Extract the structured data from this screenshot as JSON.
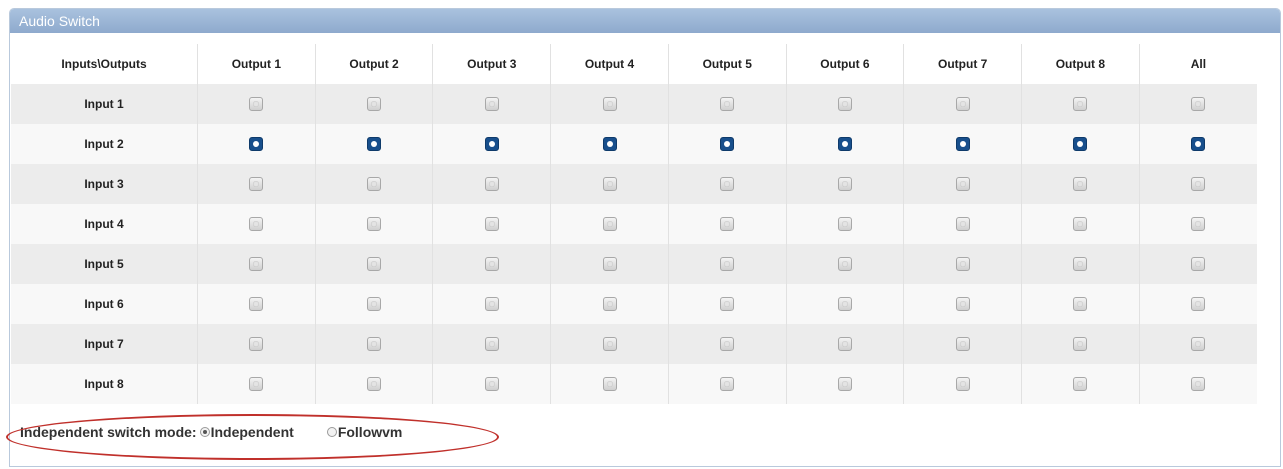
{
  "panel": {
    "title": "Audio Switch"
  },
  "matrix": {
    "corner_label": "Inputs\\Outputs",
    "columns": [
      "Output 1",
      "Output 2",
      "Output 3",
      "Output 4",
      "Output 5",
      "Output 6",
      "Output 7",
      "Output 8",
      "All"
    ],
    "rows": [
      {
        "label": "Input 1",
        "selected": [
          false,
          false,
          false,
          false,
          false,
          false,
          false,
          false,
          false
        ]
      },
      {
        "label": "Input 2",
        "selected": [
          true,
          true,
          true,
          true,
          true,
          true,
          true,
          true,
          true
        ]
      },
      {
        "label": "Input 3",
        "selected": [
          false,
          false,
          false,
          false,
          false,
          false,
          false,
          false,
          false
        ]
      },
      {
        "label": "Input 4",
        "selected": [
          false,
          false,
          false,
          false,
          false,
          false,
          false,
          false,
          false
        ]
      },
      {
        "label": "Input 5",
        "selected": [
          false,
          false,
          false,
          false,
          false,
          false,
          false,
          false,
          false
        ]
      },
      {
        "label": "Input 6",
        "selected": [
          false,
          false,
          false,
          false,
          false,
          false,
          false,
          false,
          false
        ]
      },
      {
        "label": "Input 7",
        "selected": [
          false,
          false,
          false,
          false,
          false,
          false,
          false,
          false,
          false
        ]
      },
      {
        "label": "Input 8",
        "selected": [
          false,
          false,
          false,
          false,
          false,
          false,
          false,
          false,
          false
        ]
      }
    ]
  },
  "mode": {
    "label": "Independent switch mode:",
    "options": [
      {
        "label": "Independent",
        "checked": true
      },
      {
        "label": "Followvm",
        "checked": false
      }
    ]
  },
  "colors": {
    "selected": "#184f8c",
    "header": "#9bb6d6",
    "annotation": "#c0302b"
  }
}
